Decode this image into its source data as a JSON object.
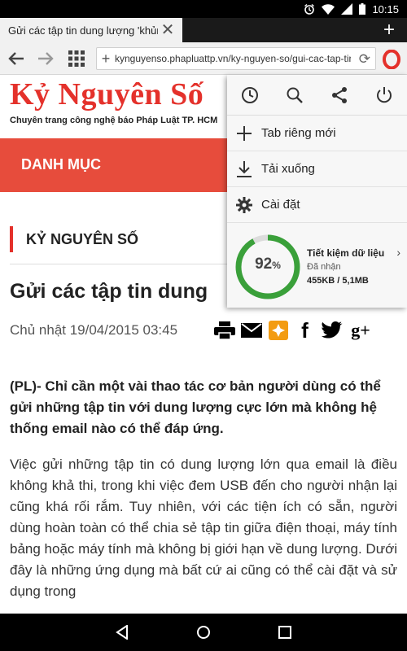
{
  "status_bar": {
    "time": "10:15",
    "icons": [
      "alarm-icon",
      "wifi-icon",
      "signal-icon",
      "battery-icon"
    ]
  },
  "tabs": {
    "active_title": "Gửi các tập tin dung lượng 'khủng",
    "new_tab_icon": "plus-icon"
  },
  "address_bar": {
    "url": "kynguyenso.phapluattp.vn/ky-nguyen-so/gui-cac-tap-tin"
  },
  "site": {
    "logo": "Kỷ Nguyên Số",
    "tagline": "Chuyên trang công nghệ báo Pháp Luật TP. HCM",
    "menu_label": "DANH MỤC",
    "brand_color": "#e74c3c"
  },
  "article": {
    "section": "KỶ NGUYÊN SỐ",
    "title": "Gửi các tập tin dung",
    "date": "Chủ nhật 19/04/2015 03:45",
    "share_icons": [
      "print-icon",
      "email-icon",
      "zing-icon",
      "facebook-icon",
      "twitter-icon",
      "google-plus-icon"
    ],
    "lead": "(PL)- Chỉ cần một vài thao tác cơ bản người dùng có thể gửi những tập tin với dung lượng cực lớn mà không hệ thống email nào có thể đáp ứng.",
    "body": "Việc gửi những tập tin có dung lượng lớn qua email là điều không khả thi, trong khi việc đem USB đến cho người nhận lại cũng khá rối rắm. Tuy nhiên, với các tiện ích có sẵn, người dùng hoàn toàn có thể chia sẻ tập tin giữa điện thoại, máy tính bảng hoặc máy tính mà không bị giới hạn về dung lượng. Dưới đây là những ứng dụng mà bất cứ ai cũng có thể cài đặt và sử dụng trong"
  },
  "opera_menu": {
    "top_icons": [
      "history-icon",
      "search-icon",
      "share-icon",
      "power-icon"
    ],
    "items": [
      {
        "icon": "plus-icon",
        "label": "Tab riêng mới"
      },
      {
        "icon": "download-icon",
        "label": "Tải xuống"
      },
      {
        "icon": "gear-icon",
        "label": "Cài đặt"
      }
    ],
    "data_savings": {
      "percent": "92",
      "percent_sign": "%",
      "percent_value": 0.92,
      "title": "Tiết kiệm dữ liệu",
      "subtitle": "Đã nhận",
      "amount": "455KB / 5,1MB",
      "gauge_color": "#3aa03a"
    }
  },
  "nav_bar": {
    "icons": [
      "back-icon",
      "home-icon",
      "recents-icon"
    ]
  }
}
